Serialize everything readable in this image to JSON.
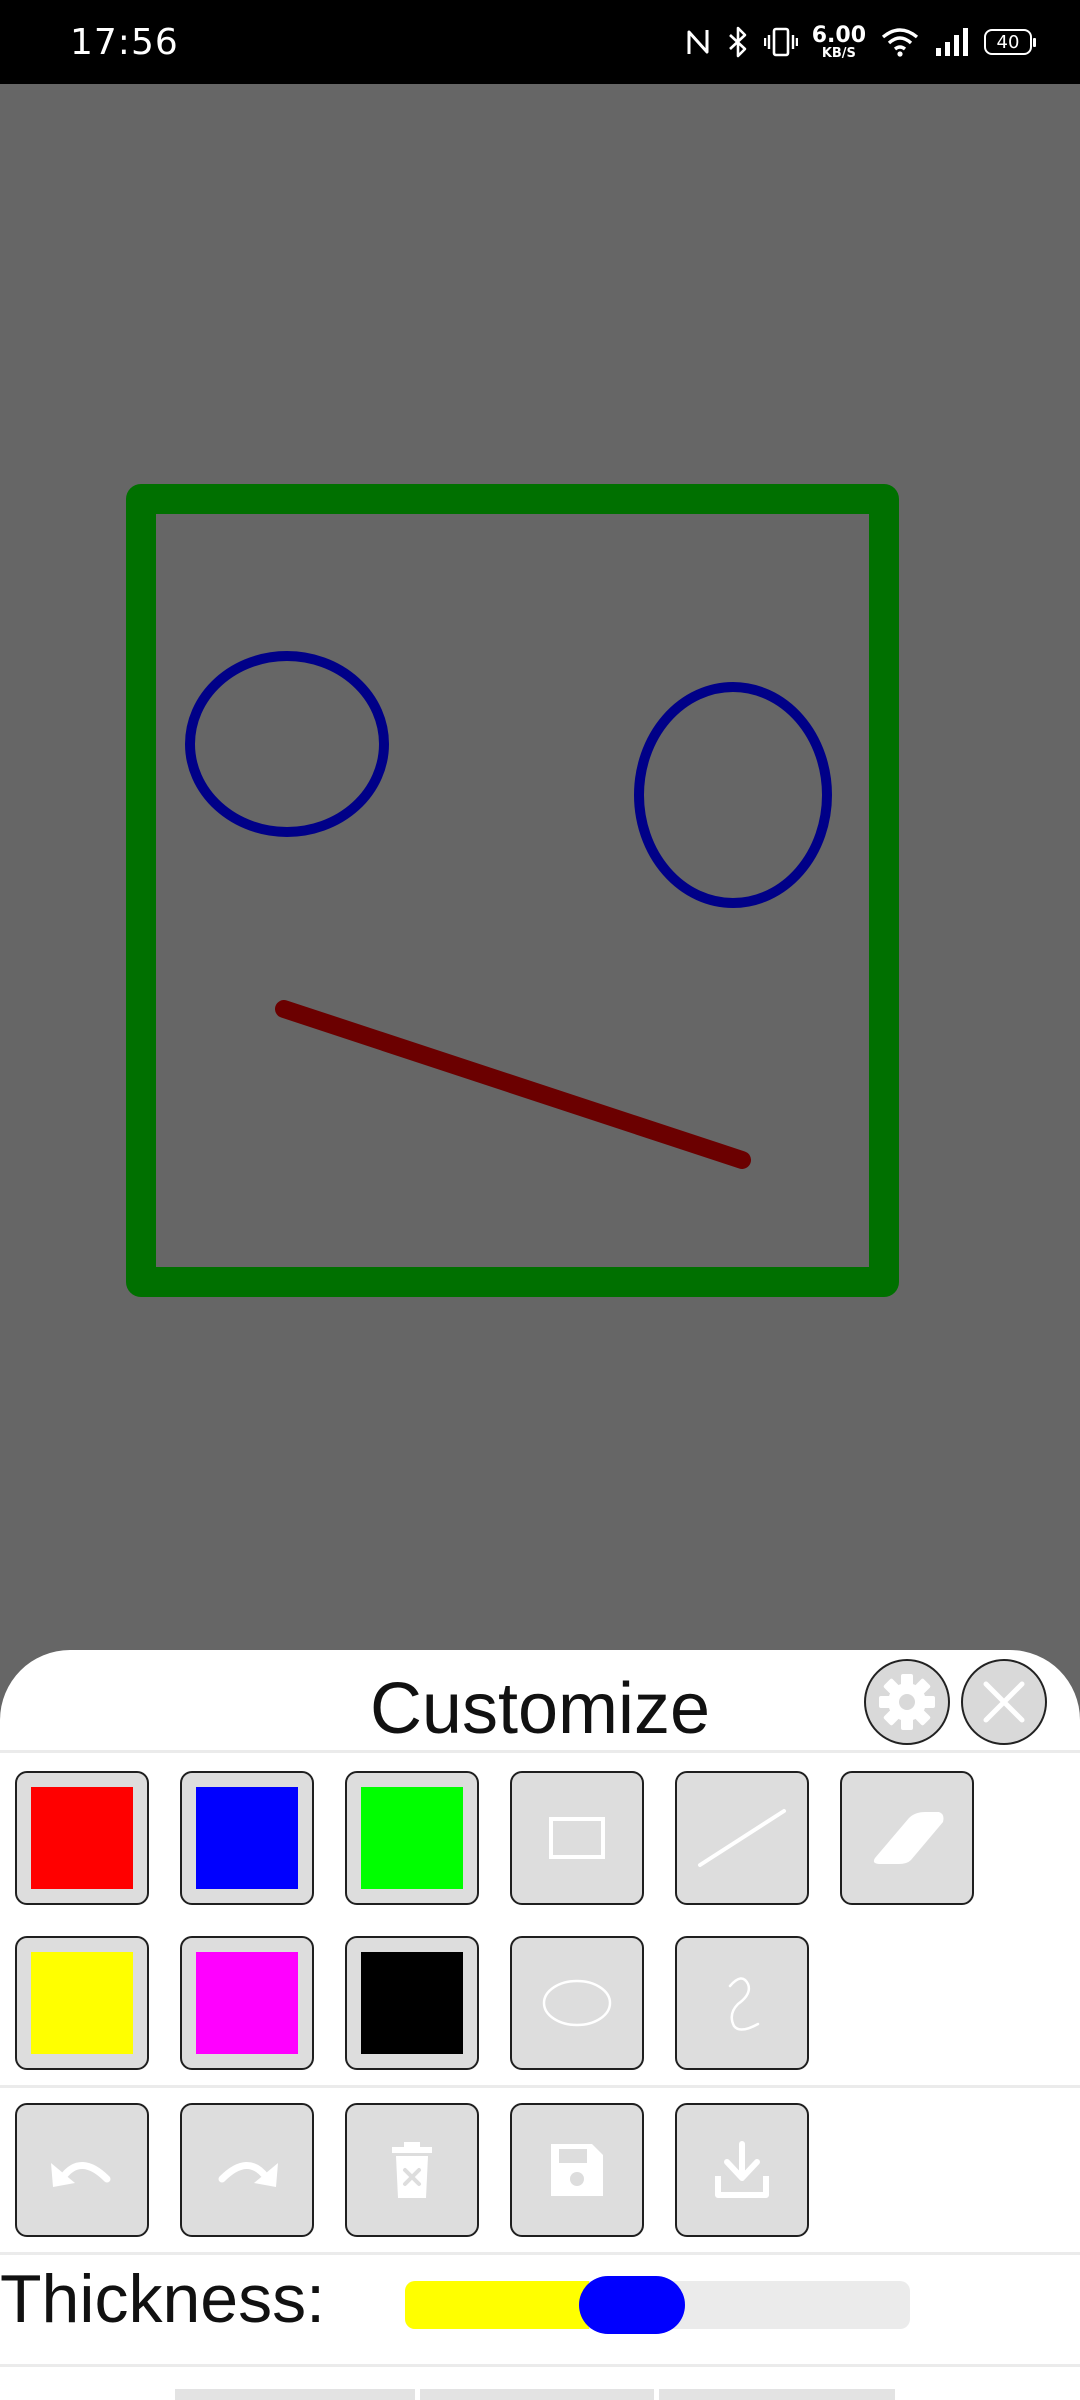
{
  "status_bar": {
    "time": "17:56",
    "net_speed_value": "6.00",
    "net_speed_unit": "KB/S",
    "battery": "40",
    "icons": [
      "nfc-icon",
      "bluetooth-icon",
      "vibrate-icon",
      "wifi-icon",
      "signal-icon",
      "battery-icon"
    ]
  },
  "canvas": {
    "background": "#666666",
    "shapes": [
      {
        "kind": "rectangle",
        "color": "#007000"
      },
      {
        "kind": "ellipse",
        "color": "#000088"
      },
      {
        "kind": "ellipse",
        "color": "#000088"
      },
      {
        "kind": "line",
        "color": "#6b0000"
      }
    ]
  },
  "panel": {
    "title": "Customize",
    "colors": [
      "#ff0000",
      "#0000ff",
      "#00ff00",
      "#ffff00",
      "#ff00ff",
      "#000000"
    ],
    "shape_tools": [
      "rectangle-tool",
      "line-tool",
      "eraser-tool",
      "ellipse-tool",
      "freehand-tool"
    ],
    "actions": [
      "undo",
      "redo",
      "delete",
      "save",
      "download"
    ],
    "thickness_label": "Thickness:",
    "thickness_level": 0.45,
    "slider_fill_color": "#ffff00",
    "slider_thumb_color": "#0000ff"
  }
}
